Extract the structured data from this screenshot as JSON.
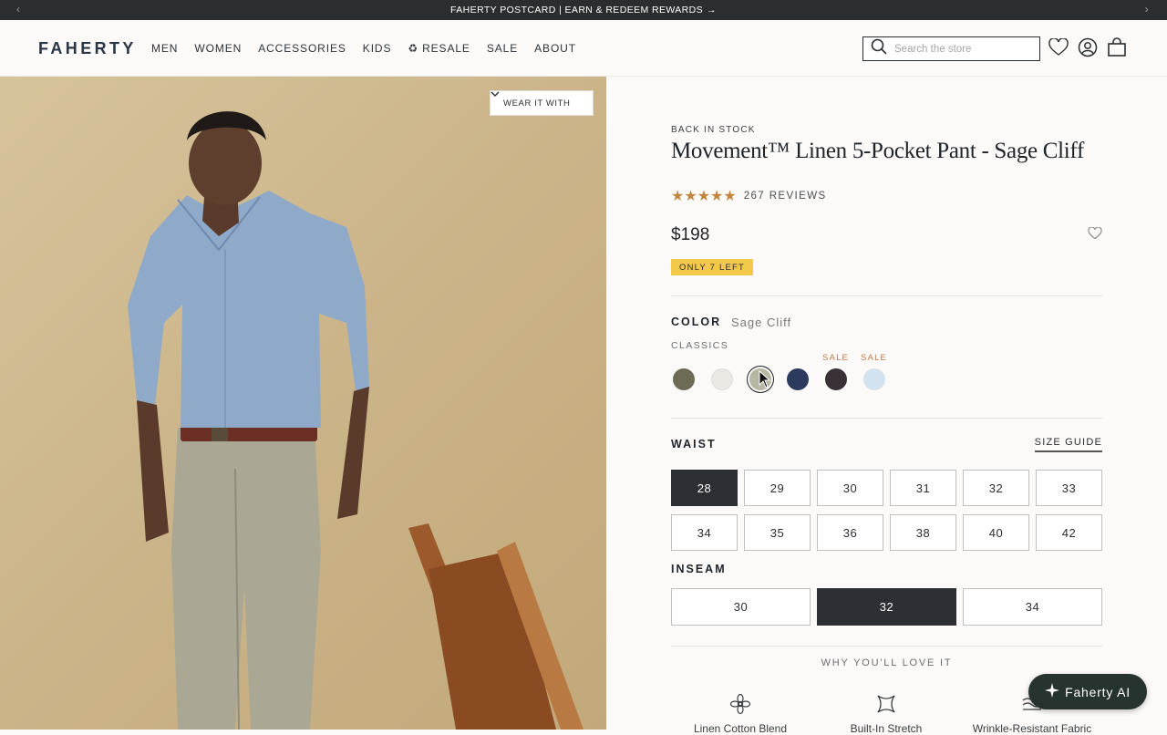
{
  "announcement": {
    "text": "FAHERTY POSTCARD | EARN & REDEEM REWARDS",
    "arrow": "→"
  },
  "header": {
    "logo": "FAHERTY",
    "nav": [
      "MEN",
      "WOMEN",
      "ACCESSORIES",
      "KIDS",
      "RESALE",
      "SALE",
      "ABOUT"
    ],
    "resale_icon": "♻",
    "search_placeholder": "Search the store"
  },
  "hero": {
    "wear_it_with": "WEAR IT WITH"
  },
  "product": {
    "status": "BACK IN STOCK",
    "title": "Movement™ Linen 5-Pocket Pant - Sage Cliff",
    "rating": 5,
    "reviews": "267 REVIEWS",
    "price": "$198",
    "stock_badge": "ONLY 7 LEFT",
    "color_label": "COLOR",
    "color_value": "Sage Cliff",
    "color_group": "CLASSICS",
    "swatches": [
      {
        "color": "#6d6a55",
        "sale": ""
      },
      {
        "color": "#ebe9e4",
        "sale": ""
      },
      {
        "color": "#b7b7a3",
        "sale": "",
        "selected": true
      },
      {
        "color": "#2c3a5e",
        "sale": ""
      },
      {
        "color": "#3a3038",
        "sale": "SALE"
      },
      {
        "color": "#d2e3ef",
        "sale": "SALE"
      }
    ],
    "waist_label": "WAIST",
    "size_guide": "SIZE GUIDE",
    "waists": [
      "28",
      "29",
      "30",
      "31",
      "32",
      "33",
      "34",
      "35",
      "36",
      "38",
      "40",
      "42"
    ],
    "selected_waist": "28",
    "inseam_label": "INSEAM",
    "inseams": [
      "30",
      "32",
      "34"
    ],
    "selected_inseam": "32",
    "why_label": "WHY YOU'LL LOVE IT",
    "features": [
      "Linen Cotton Blend",
      "Built-In Stretch",
      "Wrinkle-Resistant Fabric"
    ]
  },
  "assistant": {
    "label": "Faherty AI"
  },
  "colors": {
    "accent_star": "#c4853e",
    "badge": "#f3c94b",
    "dark": "#2c2f33",
    "sale": "#c17a4a"
  }
}
